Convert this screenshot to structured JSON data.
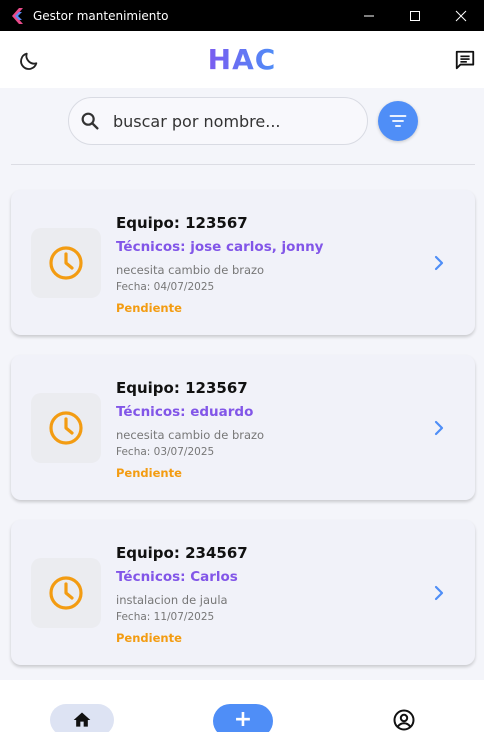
{
  "window": {
    "title": "Gestor mantenimiento"
  },
  "header": {
    "logo": "HAC"
  },
  "search": {
    "placeholder": "buscar por nombre..."
  },
  "colors": {
    "accent": "#4f8ef7",
    "technician": "#8256e8",
    "status_pending": "#f39c12"
  },
  "orders": [
    {
      "equipo": "Equipo: 123567",
      "tecnicos": "Técnicos: jose carlos, jonny",
      "descripcion": "necesita cambio de brazo",
      "fecha": "Fecha: 04/07/2025",
      "estado": "Pendiente",
      "icon": "clock-icon"
    },
    {
      "equipo": "Equipo: 123567",
      "tecnicos": "Técnicos: eduardo",
      "descripcion": "necesita cambio de brazo",
      "fecha": "Fecha: 03/07/2025",
      "estado": "Pendiente",
      "icon": "clock-icon"
    },
    {
      "equipo": "Equipo: 234567",
      "tecnicos": "Técnicos: Carlos",
      "descripcion": "instalacion de jaula",
      "fecha": "Fecha: 11/07/2025",
      "estado": "Pendiente",
      "icon": "clock-icon"
    }
  ],
  "nav": {
    "items": [
      {
        "icon": "home-icon",
        "active": true
      },
      {
        "icon": "add-icon",
        "label": "+"
      },
      {
        "icon": "account-icon"
      }
    ]
  }
}
